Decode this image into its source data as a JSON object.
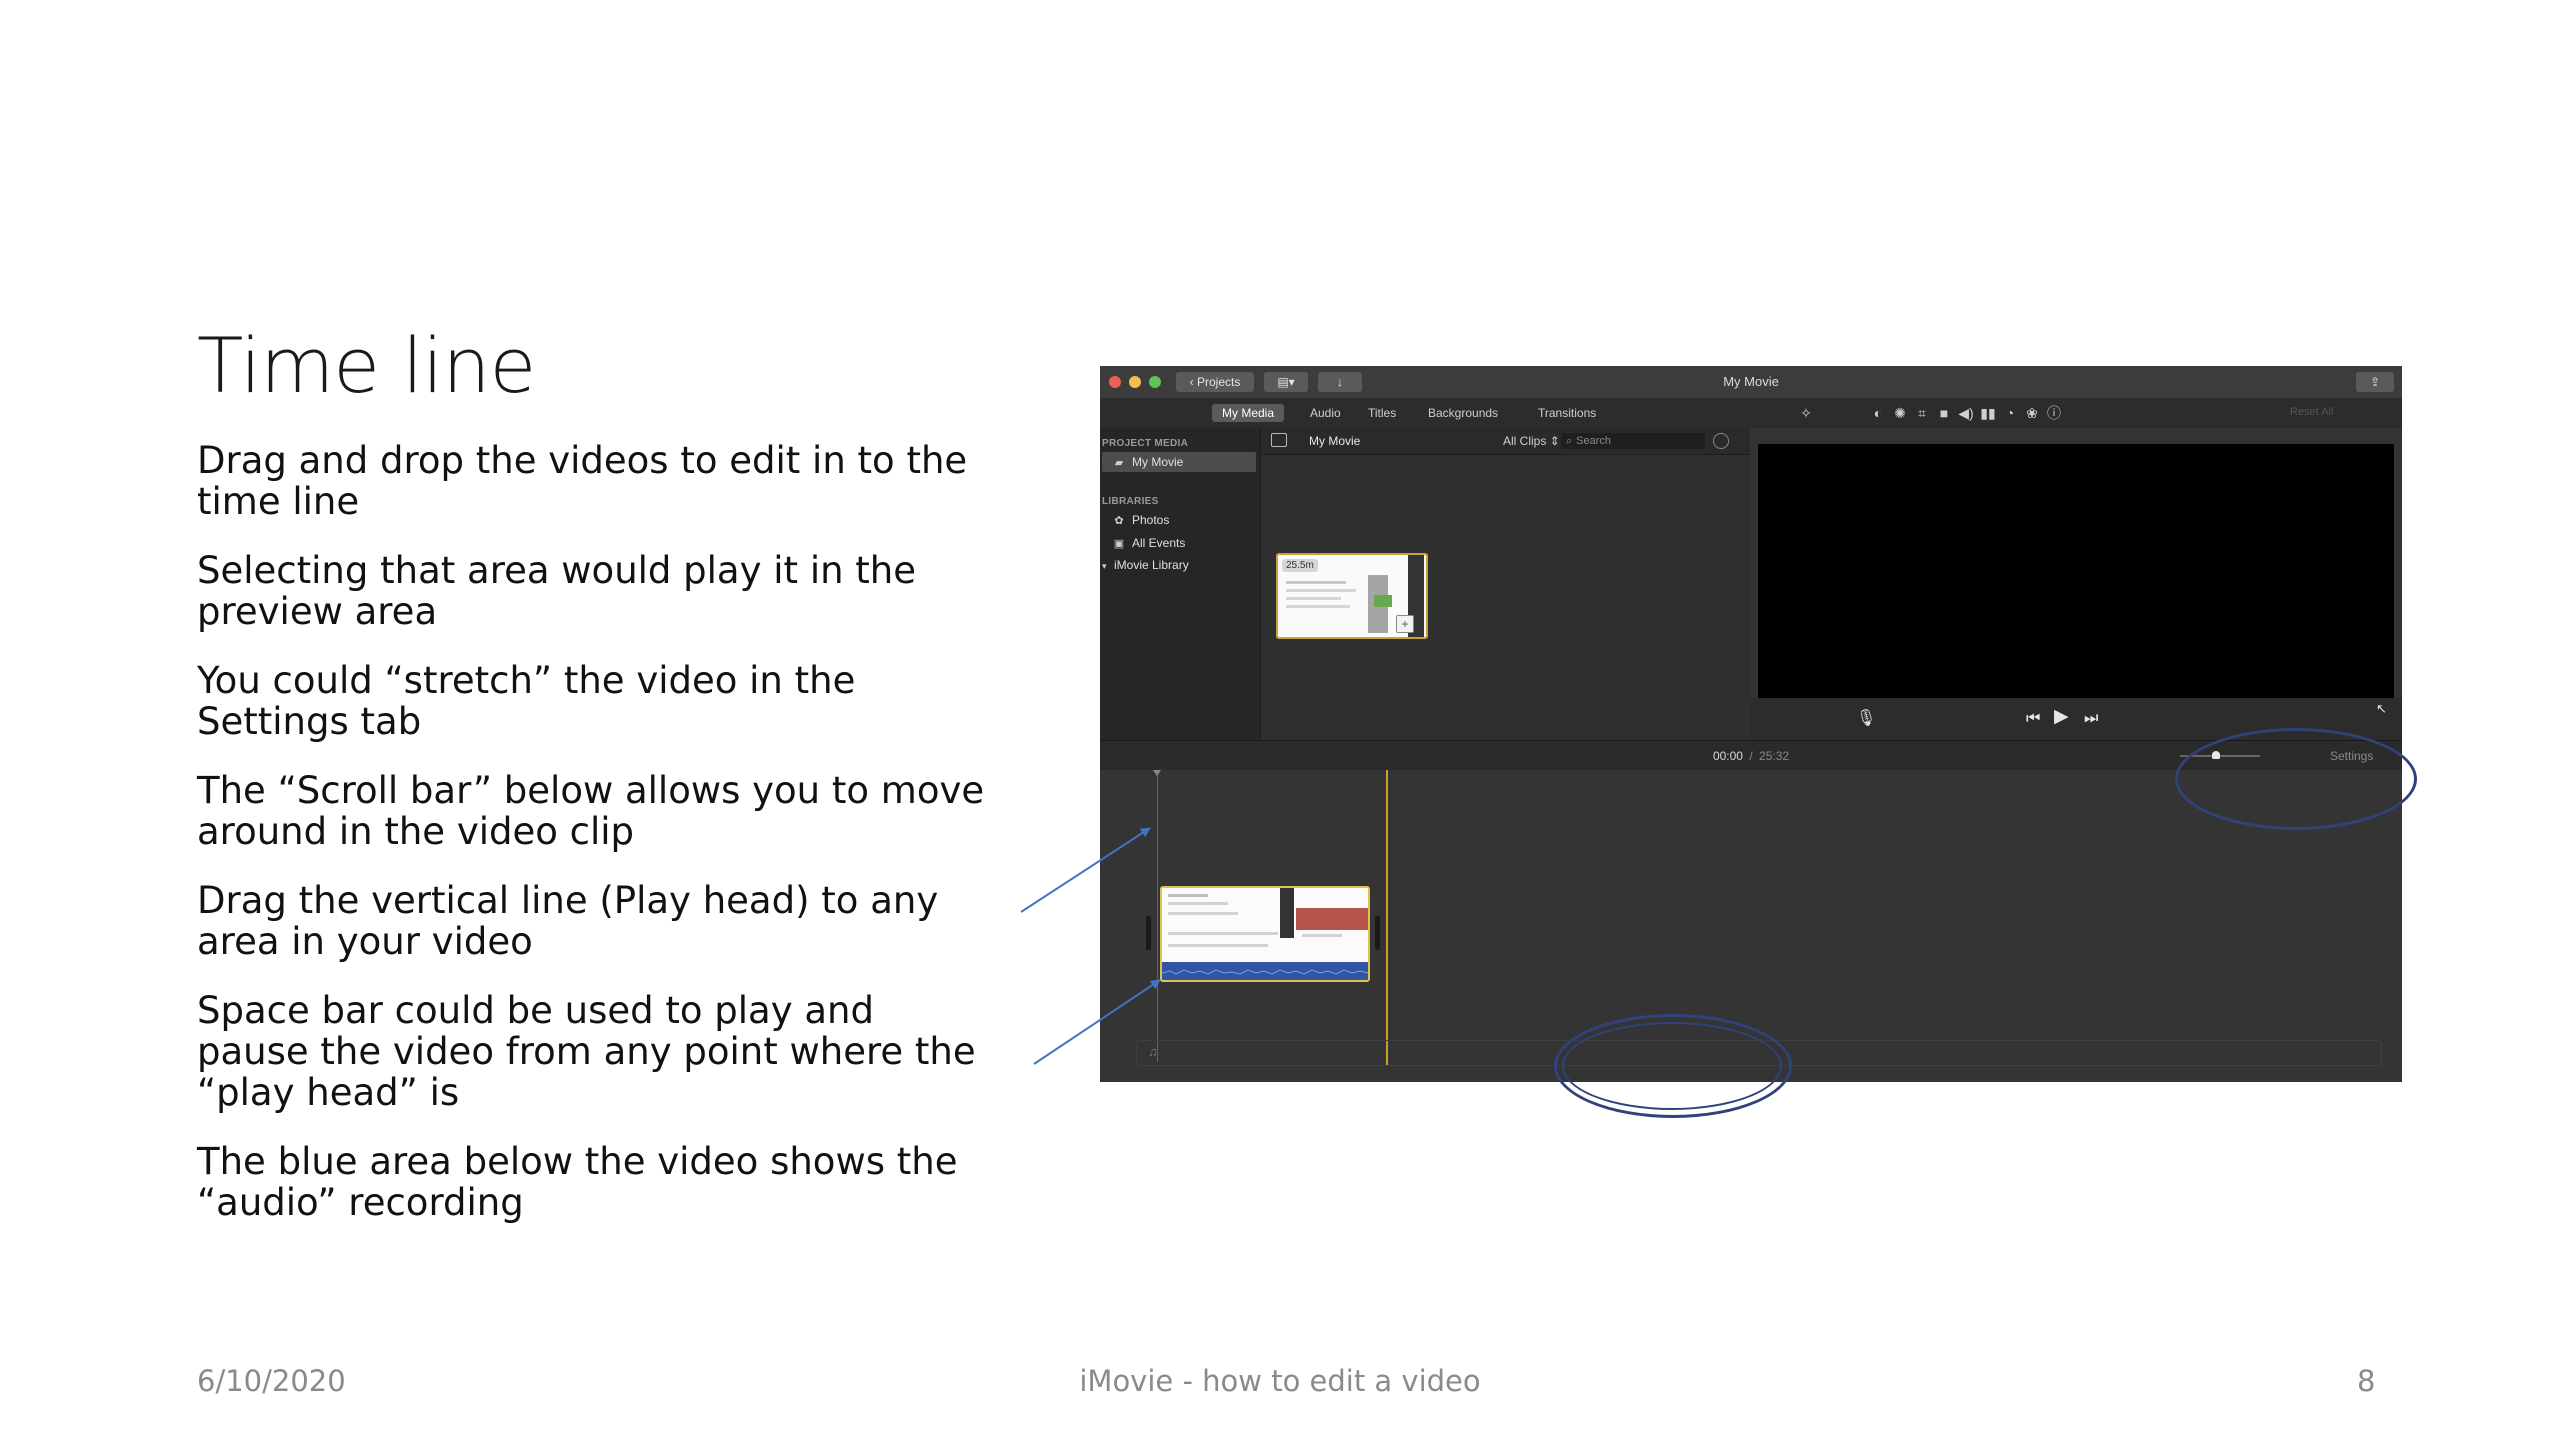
{
  "slide": {
    "title": "Time line",
    "bullets": [
      "Drag and drop the videos to edit in to the time line",
      "Selecting that area would play it in the preview area",
      "You could “stretch” the video in the Settings tab",
      "The “Scroll bar” below allows you to move around in the video clip",
      "Drag the vertical line (Play head) to any area in your video",
      "Space bar could be used to play and pause the video from any point where the “play head” is",
      "The blue area below the video shows the “audio” recording"
    ],
    "footer": {
      "date": "6/10/2020",
      "title": "iMovie - how to edit a video",
      "page": "8"
    }
  },
  "imovie": {
    "window_title": "My Movie",
    "projects_button": "Projects",
    "tabs": [
      "My Media",
      "Audio",
      "Titles",
      "Backgrounds",
      "Transitions"
    ],
    "active_tab": "My Media",
    "sidebar": {
      "project_media_header": "PROJECT MEDIA",
      "project_item": "My Movie",
      "libraries_header": "LIBRARIES",
      "library_items": [
        "Photos",
        "All Events",
        "iMovie Library"
      ]
    },
    "browser": {
      "project_name": "My Movie",
      "filter": "All Clips",
      "search_placeholder": "Search",
      "clip_duration": "25.5m"
    },
    "viewer": {
      "reset_all": "Reset All"
    },
    "timeline": {
      "current_time": "00:00",
      "separator": "/",
      "total_time": "25:32",
      "settings_label": "Settings"
    }
  },
  "colors": {
    "annotation_blue": "#4472c4",
    "callout_navy": "#30427a",
    "clip_border": "#e3c14c",
    "playhead": "#c9a227",
    "audio_wave": "#3a62b8"
  },
  "icons": [
    "magic-wand-icon",
    "color-balance-icon",
    "color-correction-icon",
    "crop-icon",
    "stabilization-icon",
    "volume-icon",
    "equalizer-icon",
    "speed-icon",
    "filter-icon",
    "info-icon",
    "microphone-icon",
    "skip-back-icon",
    "play-icon",
    "skip-forward-icon",
    "share-icon",
    "fullscreen-icon"
  ]
}
